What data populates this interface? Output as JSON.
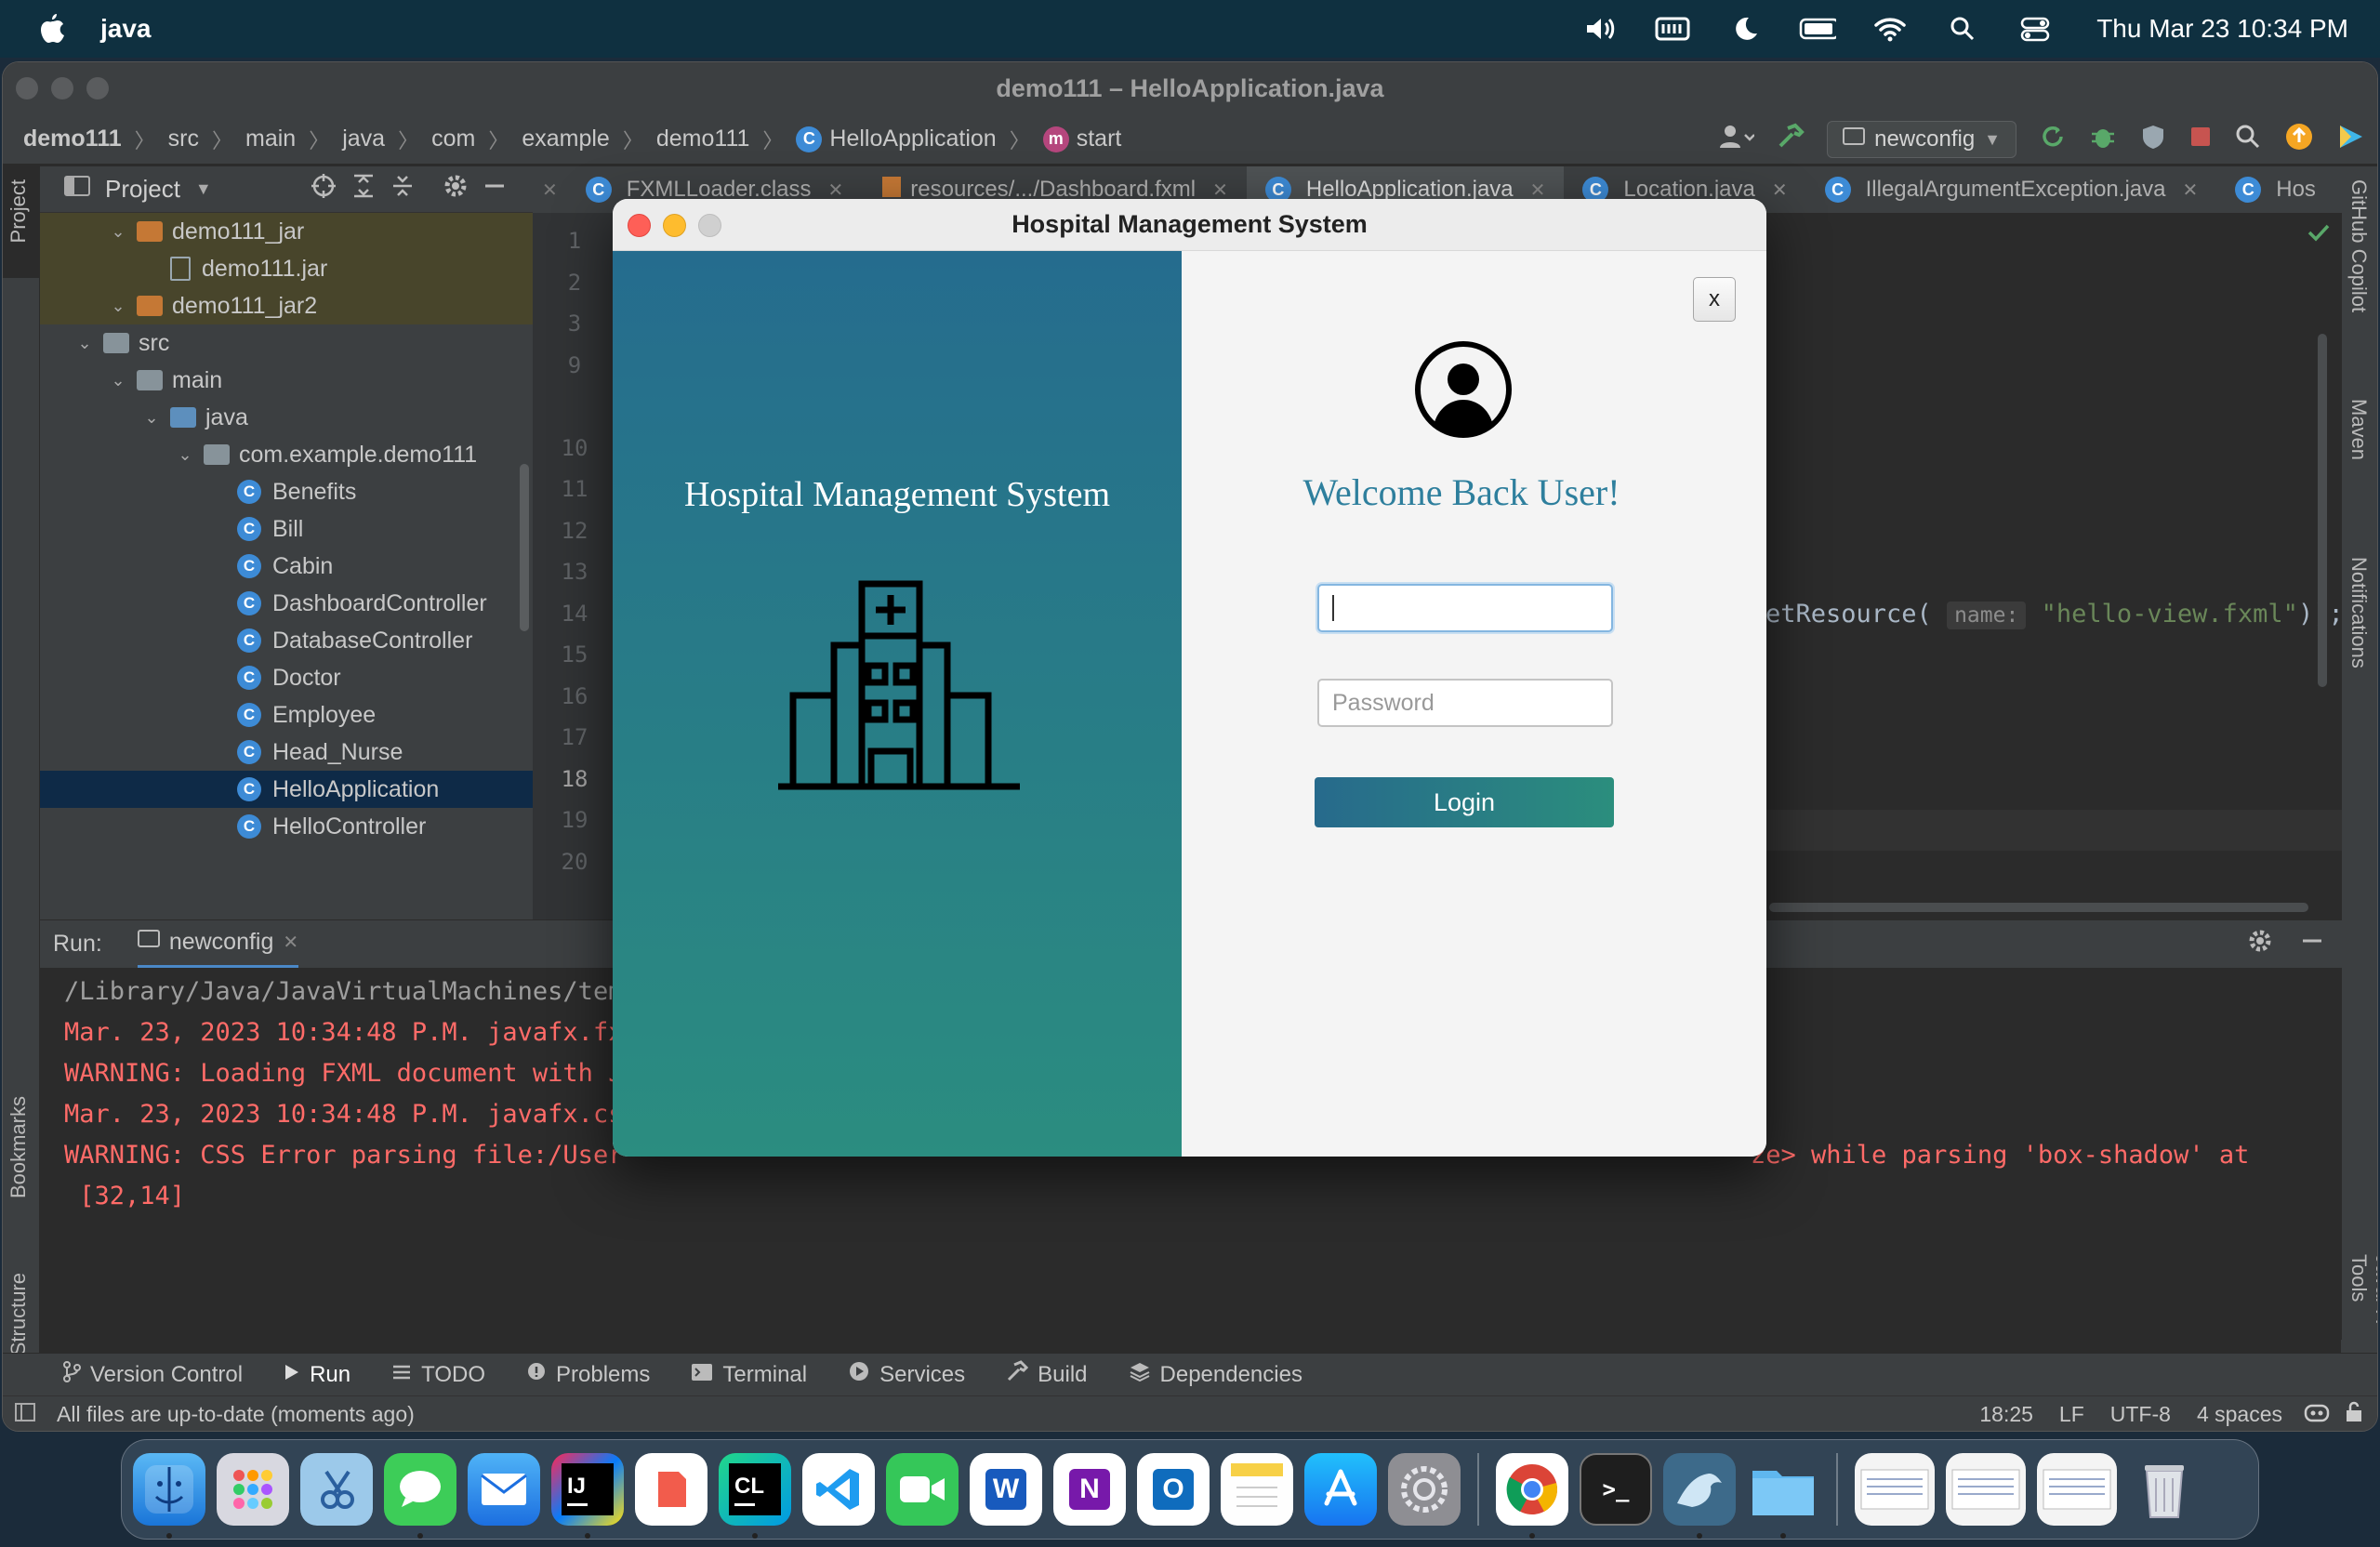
{
  "menubar": {
    "app_name": "java",
    "clock": "Thu Mar 23  10:34 PM"
  },
  "ide": {
    "window_title": "demo111 – HelloApplication.java",
    "breadcrumbs": [
      "demo111",
      "src",
      "main",
      "java",
      "com",
      "example",
      "demo111",
      "HelloApplication",
      "start"
    ],
    "run_config": "newconfig",
    "project_panel_title": "Project",
    "tree": [
      {
        "label": "demo111_jar",
        "kind": "folder-orange",
        "indent": 1,
        "expanded": true
      },
      {
        "label": "demo111.jar",
        "kind": "jar",
        "indent": 2
      },
      {
        "label": "demo111_jar2",
        "kind": "folder-orange",
        "indent": 1,
        "expanded": true
      },
      {
        "label": "src",
        "kind": "folder",
        "indent": 0,
        "expanded": true
      },
      {
        "label": "main",
        "kind": "folder",
        "indent": 1,
        "expanded": true
      },
      {
        "label": "java",
        "kind": "folder-blue",
        "indent": 2,
        "expanded": true
      },
      {
        "label": "com.example.demo111",
        "kind": "package",
        "indent": 3,
        "expanded": true
      },
      {
        "label": "Benefits",
        "kind": "class",
        "indent": 4
      },
      {
        "label": "Bill",
        "kind": "class",
        "indent": 4
      },
      {
        "label": "Cabin",
        "kind": "class",
        "indent": 4
      },
      {
        "label": "DashboardController",
        "kind": "class",
        "indent": 4
      },
      {
        "label": "DatabaseController",
        "kind": "class",
        "indent": 4
      },
      {
        "label": "Doctor",
        "kind": "class",
        "indent": 4
      },
      {
        "label": "Employee",
        "kind": "class",
        "indent": 4
      },
      {
        "label": "Head_Nurse",
        "kind": "class",
        "indent": 4
      },
      {
        "label": "HelloApplication",
        "kind": "class",
        "indent": 4,
        "selected": true
      },
      {
        "label": "HelloController",
        "kind": "class",
        "indent": 4
      }
    ],
    "editor_tabs": [
      "FXMLLoader.class",
      "resources/.../Dashboard.fxml",
      "HelloApplication.java",
      "Location.java",
      "IllegalArgumentException.java",
      "Hos"
    ],
    "line_numbers": [
      "1",
      "2",
      "3",
      "9",
      "",
      "10",
      "11",
      "12",
      "13",
      "14",
      "15",
      "16",
      "17",
      "18",
      "19",
      "20"
    ],
    "code_visible": {
      "prefix": "etResource(",
      "hint": "name:",
      "string": "\"hello-view.fxml\"",
      "suffix": "));"
    },
    "run": {
      "label": "Run:",
      "tab": "newconfig",
      "lines": [
        {
          "text": "/Library/Java/JavaVirtualMachines/tem",
          "style": "grey"
        },
        {
          "text": "Mar. 23, 2023 10:34:48 P.M. javafx.fx",
          "style": "red"
        },
        {
          "text": "WARNING: Loading FXML document with J",
          "style": "red"
        },
        {
          "text": "Mar. 23, 2023 10:34:48 P.M. javafx.cs",
          "style": "red"
        },
        {
          "text": "WARNING: CSS Error parsing file:/User",
          "style": "red"
        },
        {
          "text": " [32,14]",
          "style": "red"
        }
      ],
      "trailing_text": "ze> while parsing 'box-shadow' at"
    },
    "bottom_tools": [
      "Version Control",
      "Run",
      "TODO",
      "Problems",
      "Terminal",
      "Services",
      "Build",
      "Dependencies"
    ],
    "status": {
      "message": "All files are up-to-date (moments ago)",
      "position": "18:25",
      "line_sep": "LF",
      "encoding": "UTF-8",
      "indent": "4 spaces"
    },
    "side_tabs_left": [
      "Project",
      "Bookmarks",
      "Structure"
    ],
    "side_tabs_right": [
      "GitHub Copilot",
      "Maven",
      "Notifications",
      "JavaFX Tools"
    ]
  },
  "dialog": {
    "title": "Hospital Management System",
    "left_title": "Hospital Management System",
    "close_label": "x",
    "welcome": "Welcome Back User!",
    "username_value": "",
    "password_placeholder": "Password",
    "login_label": "Login"
  },
  "colors": {
    "gradient_top": "#256c8e",
    "gradient_bottom": "#2b8d80",
    "welcome_text": "#2e7f9d"
  },
  "dock_apps": [
    "Finder",
    "Launchpad",
    "Preview",
    "Messages",
    "Mail",
    "IntelliJ IDEA",
    "Speakerdeck",
    "CLion",
    "VS Code",
    "FaceTime",
    "Word",
    "OneNote",
    "Outlook",
    "Notes",
    "App Store",
    "System Settings",
    "Chrome",
    "Terminal",
    "MySQL Workbench",
    "Downloads",
    "Window 1",
    "Window 2",
    "Window 3",
    "Trash"
  ]
}
